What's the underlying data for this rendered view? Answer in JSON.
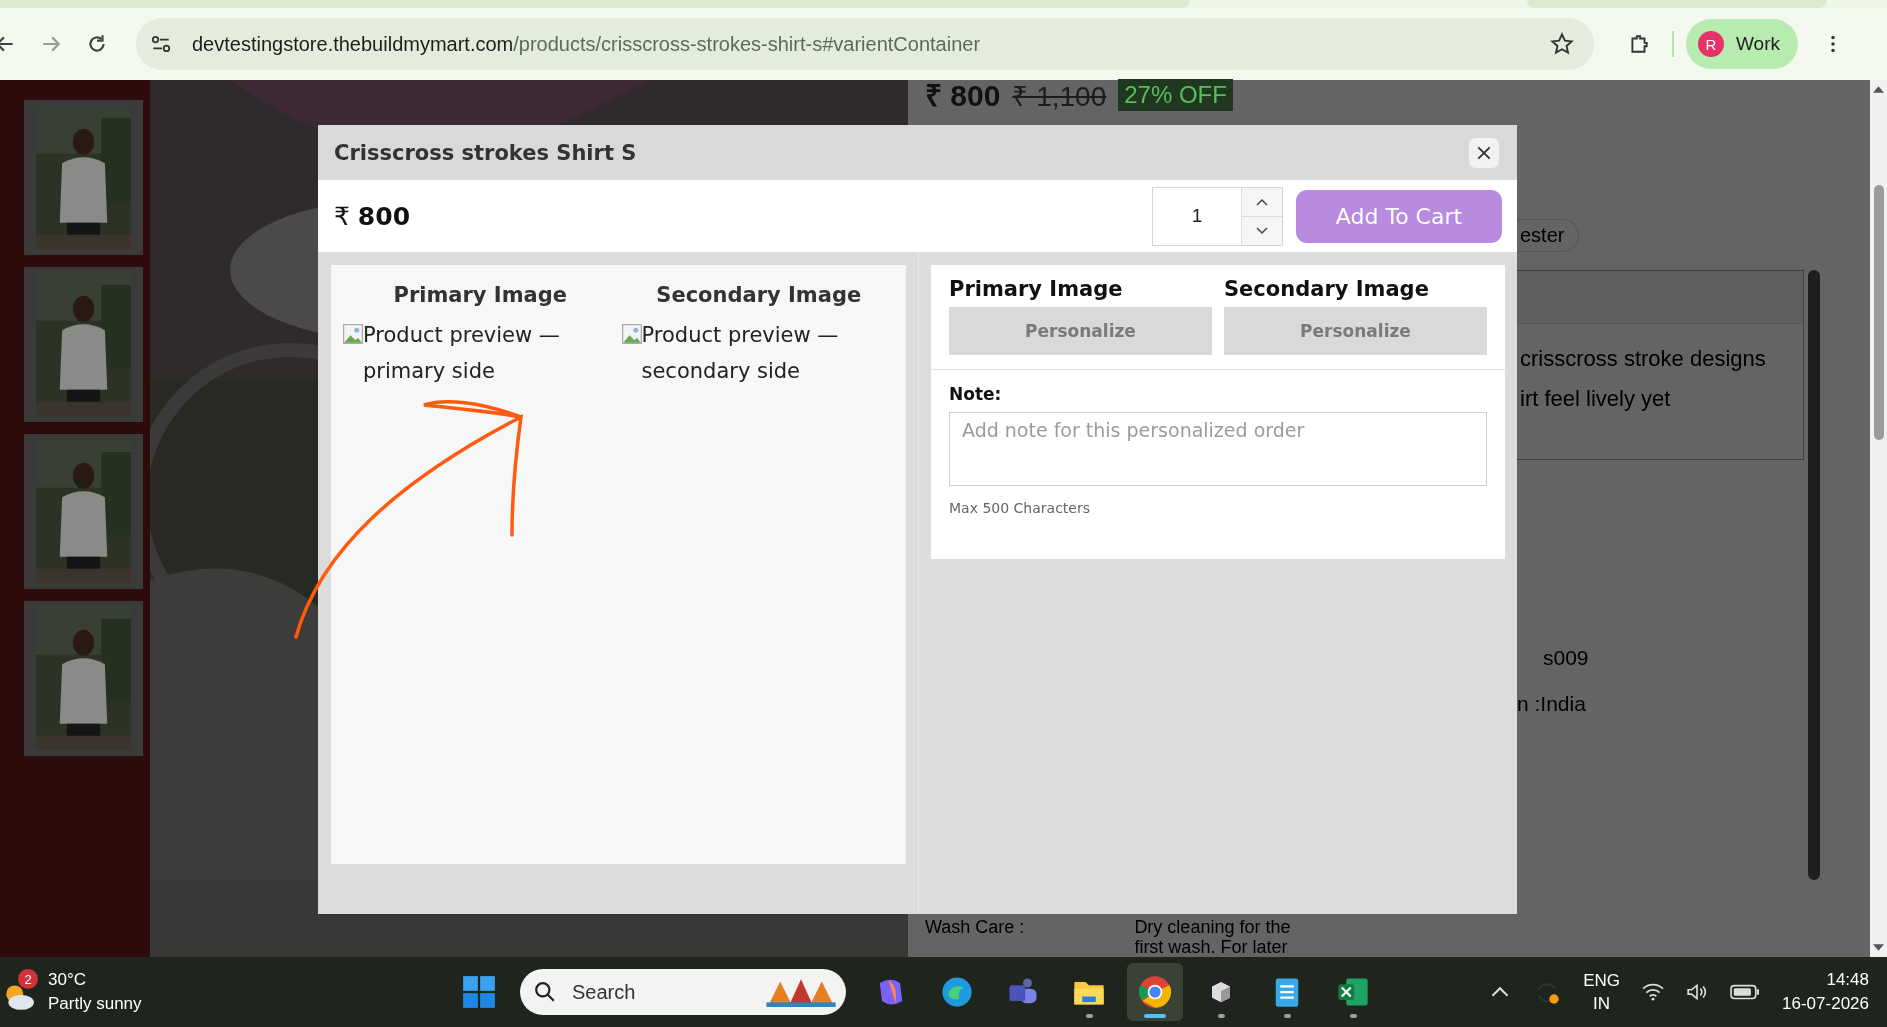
{
  "browser": {
    "url_host": "devtestingstore.thebuildmymart.com",
    "url_path": "/products/crisscross-strokes-shirt-s#varientContainer",
    "profile": {
      "initial": "R",
      "label": "Work"
    }
  },
  "background_page": {
    "price": "₹ 800",
    "old_price": "₹ 1,100",
    "discount": "27% OFF",
    "chip": "ester",
    "description_lines": [
      "crisscross stroke designs",
      "irt feel lively yet"
    ],
    "sku": "s009",
    "origin": "n :India",
    "wash_care_label": "Wash Care :",
    "wash_care_lines": [
      "Dry cleaning for the",
      "first wash. For later"
    ]
  },
  "modal": {
    "title": "Crisscross strokes Shirt S",
    "price": "₹ **800**",
    "quantity": "1",
    "add_to_cart": "Add To Cart",
    "previews": [
      {
        "heading": "Primary Image",
        "alt": "Product preview — primary side"
      },
      {
        "heading": "Secondary Image",
        "alt": "Product preview — secondary side"
      }
    ],
    "personalize": [
      {
        "heading": "Primary Image",
        "button": "Personalize"
      },
      {
        "heading": "Secondary Image",
        "button": "Personalize"
      }
    ],
    "note": {
      "label": "Note:",
      "placeholder": "Add note for this personalized order",
      "hint": "Max 500 Characters"
    }
  },
  "taskbar": {
    "weather": {
      "badge": "2",
      "temperature": "30°C",
      "condition": "Partly sunny"
    },
    "search": {
      "label": "Search"
    },
    "apps": [
      {
        "kind": "copilot",
        "running": false,
        "selected": false
      },
      {
        "kind": "edge",
        "running": false,
        "selected": false
      },
      {
        "kind": "teams",
        "running": false,
        "selected": false
      },
      {
        "kind": "files",
        "running": true,
        "selected": false
      },
      {
        "kind": "chrome",
        "running": true,
        "selected": true
      },
      {
        "kind": "cube",
        "running": true,
        "selected": false
      },
      {
        "kind": "notepad",
        "running": true,
        "selected": false
      },
      {
        "kind": "excel",
        "running": true,
        "selected": false
      }
    ],
    "tray": {
      "language": "ENG",
      "region": "IN",
      "time": "14:48",
      "date": "16-07-2026"
    }
  }
}
